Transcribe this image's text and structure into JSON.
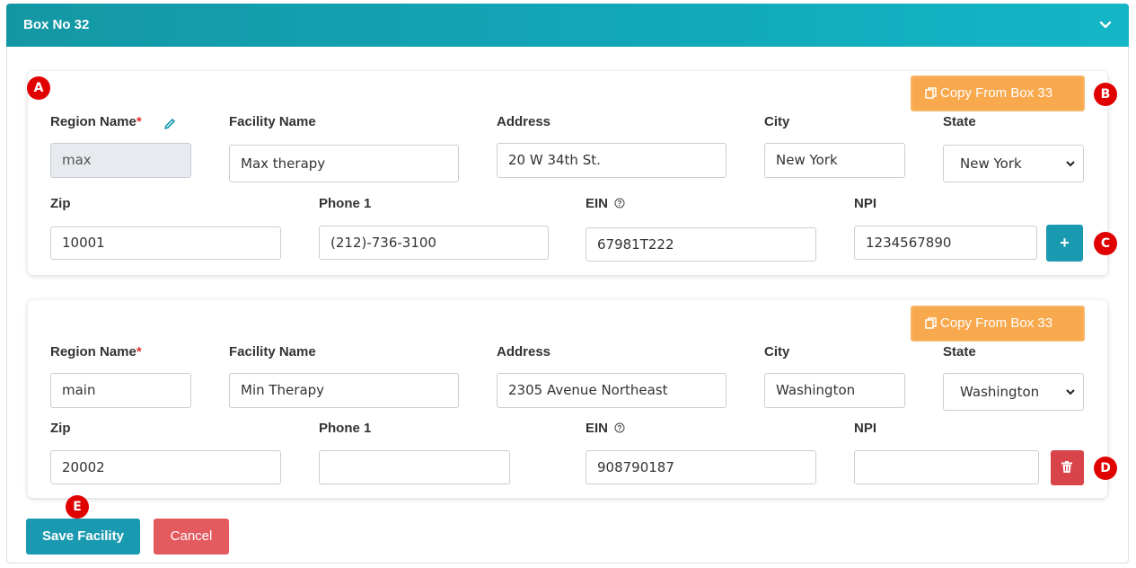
{
  "header": {
    "title": "Box No 32",
    "chevron_icon": "chevron-down-icon"
  },
  "labels": {
    "region_name": "Region Name",
    "required_mark": "*",
    "facility_name": "Facility Name",
    "address": "Address",
    "city": "City",
    "state": "State",
    "zip": "Zip",
    "phone1": "Phone 1",
    "ein": "EIN",
    "npi": "NPI"
  },
  "copy_button_label": "Copy From Box 33",
  "facilities": [
    {
      "region_name": "max",
      "facility_name": "Max therapy",
      "address": "20 W 34th St.",
      "city": "New York",
      "state": "New York",
      "zip": "10001",
      "phone1": "(212)-736-3100",
      "ein": "67981T222",
      "npi": "1234567890",
      "action": "+"
    },
    {
      "region_name": "main",
      "facility_name": "Min Therapy",
      "address": "2305 Avenue Northeast",
      "city": "Washington",
      "state": "Washington",
      "zip": "20002",
      "phone1": "",
      "ein": "908790187",
      "npi": ""
    }
  ],
  "annotations": {
    "a": "A",
    "b": "B",
    "c": "C",
    "d": "D",
    "e": "E"
  },
  "footer": {
    "save_label": "Save Facility",
    "cancel_label": "Cancel"
  },
  "colors": {
    "teal": "#1a9ab0",
    "orange": "#f9a94d",
    "red": "#d9444a",
    "badge": "#e00000"
  }
}
